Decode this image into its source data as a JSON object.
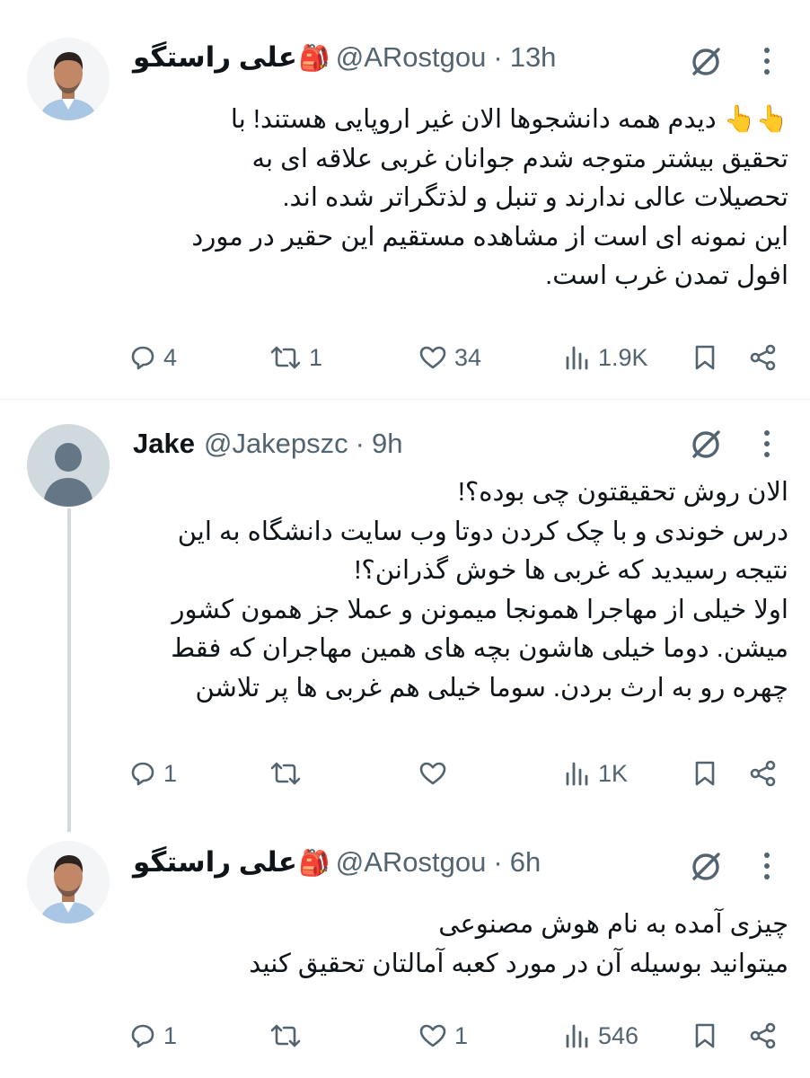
{
  "tweets": [
    {
      "author_name": "علی راستگو",
      "badge": "🎒",
      "handle": "@ARostgou",
      "separator": "·",
      "time": "13h",
      "lines": [
        "👆👆 دیدم همه دانشجوها الان غیر اروپایی هستند! با",
        "تحقیق بیشتر متوجه شدم جوانان غربی علاقه ای به",
        "تحصیلات عالی ندارند و تنبل و لذتگراتر شده اند.",
        "این نمونه ای است از مشاهده مستقیم این حقیر در مورد",
        "افول تمدن غرب است."
      ],
      "stats": {
        "replies": "4",
        "reposts": "1",
        "likes": "34",
        "views": "1.9K"
      }
    },
    {
      "author_name": "Jake",
      "badge": "",
      "handle": "@Jakepszc",
      "separator": "·",
      "time": "9h",
      "lines": [
        "الان روش تحقیقتون چی بوده؟!",
        "درس خوندی و با چک کردن دوتا وب سایت دانشگاه به این",
        "نتیجه رسیدید که غربی ها خوش گذرانن؟!",
        "اولا خیلی از مهاجرا همونجا میمونن و عملا جز همون کشور",
        "میشن. دوما خیلی هاشون بچه های همین مهاجران که فقط",
        "چهره رو به ارث بردن. سوما خیلی هم غربی ها پر تلاشن"
      ],
      "stats": {
        "replies": "1",
        "reposts": "",
        "likes": "",
        "views": "1K"
      }
    },
    {
      "author_name": "علی راستگو",
      "badge": "🎒",
      "handle": "@ARostgou",
      "separator": "·",
      "time": "6h",
      "lines": [
        "چیزی آمده به نام هوش مصنوعی",
        "میتوانید بوسیله آن در مورد کعبه آمالتان تحقیق کنید"
      ],
      "stats": {
        "replies": "1",
        "reposts": "",
        "likes": "1",
        "views": "546"
      }
    }
  ],
  "icons": {
    "avatar_person": "man-portrait-avatar",
    "avatar_default": "default-profile-avatar",
    "grok": "grok-icon",
    "more": "more-vertical-icon",
    "reply": "reply-icon",
    "repost": "repost-icon",
    "like": "heart-icon",
    "views": "views-chart-icon",
    "bookmark": "bookmark-icon",
    "share": "share-icon"
  },
  "colors": {
    "text": "#0f1419",
    "secondary": "#536471",
    "divider": "#eff3f4",
    "thread_line": "#cfd9de",
    "default_avatar_bg": "#cfd9de",
    "default_avatar_fg": "#657786"
  }
}
